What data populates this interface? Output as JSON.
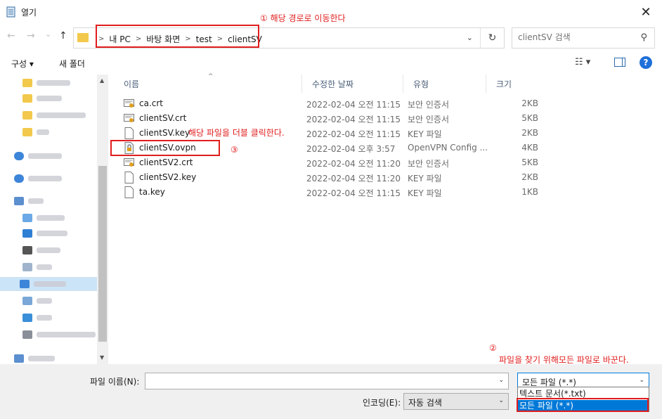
{
  "window": {
    "title": "열기",
    "close_glyph": "✕"
  },
  "nav": {
    "back": "←",
    "forward": "→",
    "recent": "⌄",
    "up": "↑"
  },
  "address": {
    "crumbs": [
      "내 PC",
      "바탕 화면",
      "test",
      "clientSV"
    ],
    "dropdown_glyph": "⌄",
    "refresh_glyph": "↻"
  },
  "search": {
    "placeholder": "clientSV 검색",
    "icon_glyph": "⚲"
  },
  "toolbar": {
    "organize": "구성 ▾",
    "new_folder": "새 폴더",
    "view_glyph": "☷ ▾",
    "help": "?"
  },
  "columns": {
    "name": "이름",
    "date": "수정한 날짜",
    "type": "유형",
    "size": "크기",
    "sort_glyph": "^"
  },
  "files": [
    {
      "name": "ca.crt",
      "date": "2022-02-04 오전 11:15",
      "type": "보안 인증서",
      "size": "2KB",
      "icon": "certificate-icon"
    },
    {
      "name": "clientSV.crt",
      "date": "2022-02-04 오전 11:15",
      "type": "보안 인증서",
      "size": "5KB",
      "icon": "certificate-icon"
    },
    {
      "name": "clientSV.key",
      "date": "2022-02-04 오전 11:15",
      "type": "KEY 파일",
      "size": "2KB",
      "icon": "document-icon"
    },
    {
      "name": "clientSV.ovpn",
      "date": "2022-02-04 오후 3:57",
      "type": "OpenVPN Config ...",
      "size": "4KB",
      "icon": "openvpn-config-icon"
    },
    {
      "name": "clientSV2.crt",
      "date": "2022-02-04 오전 11:20",
      "type": "보안 인증서",
      "size": "5KB",
      "icon": "certificate-icon"
    },
    {
      "name": "clientSV2.key",
      "date": "2022-02-04 오전 11:20",
      "type": "KEY 파일",
      "size": "2KB",
      "icon": "document-icon"
    },
    {
      "name": "ta.key",
      "date": "2022-02-04 오전 11:15",
      "type": "KEY 파일",
      "size": "1KB",
      "icon": "document-icon"
    }
  ],
  "bottom": {
    "filename_label": "파일 이름(N):",
    "filename_value": "",
    "filetype_selected": "모든 파일 (*.*)",
    "encoding_label": "인코딩(E):",
    "encoding_value": "자동 검색",
    "arrow_glyph": "⌄"
  },
  "filetype_options": [
    "텍스트 문서(*.txt)",
    "모든 파일 (*.*)"
  ],
  "annotations": {
    "a1": "① 해당 경로로 이동한다",
    "a2_num": "②",
    "a2": "파일을 찾기 위해모든 파일로 바꾼다.",
    "a3_num": "③",
    "a3": "해당 파일을 더블 클릭한다."
  },
  "colors": {
    "annotation": "#e11d1d",
    "selection": "#0078d7",
    "folder": "#f2c94c"
  }
}
